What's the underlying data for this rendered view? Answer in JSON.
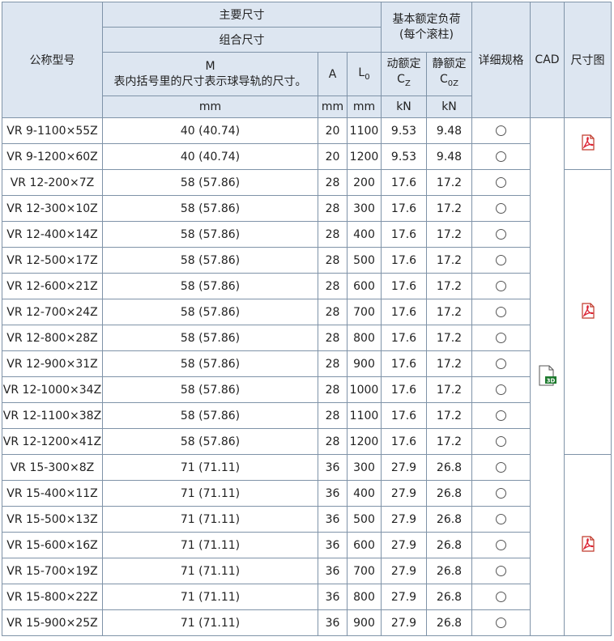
{
  "header": {
    "model": "公称型号",
    "main_dims": "主要尺寸",
    "combo_dims": "组合尺寸",
    "m_label": "M",
    "m_note": "表内括号里的尺寸表示球导轨的尺寸。",
    "a_label": "A",
    "l0_label": "L",
    "l0_sub": "0",
    "load_title": "基本额定负荷",
    "load_sub": "(每个滚柱)",
    "dyn_label": "动额定",
    "dyn_sym": "C",
    "dyn_sub": "Z",
    "stat_label": "静额定",
    "stat_sym": "C",
    "stat_sub": "0Z",
    "detail": "详细规格",
    "cad": "CAD",
    "drawing": "尺寸图",
    "unit_mm": "mm",
    "unit_kn": "kN"
  },
  "icons": {
    "detail": "circle-icon",
    "pdf": "pdf-icon",
    "cad": "cad-3d-icon"
  },
  "rows": [
    {
      "model": "VR 9-1100×55Z",
      "m": "40 (40.74)",
      "a": "20",
      "l0": "1100",
      "cz": "9.53",
      "c0z": "9.48"
    },
    {
      "model": "VR 9-1200×60Z",
      "m": "40 (40.74)",
      "a": "20",
      "l0": "1200",
      "cz": "9.53",
      "c0z": "9.48"
    },
    {
      "model": "VR 12-200×7Z",
      "m": "58 (57.86)",
      "a": "28",
      "l0": "200",
      "cz": "17.6",
      "c0z": "17.2"
    },
    {
      "model": "VR 12-300×10Z",
      "m": "58 (57.86)",
      "a": "28",
      "l0": "300",
      "cz": "17.6",
      "c0z": "17.2"
    },
    {
      "model": "VR 12-400×14Z",
      "m": "58 (57.86)",
      "a": "28",
      "l0": "400",
      "cz": "17.6",
      "c0z": "17.2"
    },
    {
      "model": "VR 12-500×17Z",
      "m": "58 (57.86)",
      "a": "28",
      "l0": "500",
      "cz": "17.6",
      "c0z": "17.2"
    },
    {
      "model": "VR 12-600×21Z",
      "m": "58 (57.86)",
      "a": "28",
      "l0": "600",
      "cz": "17.6",
      "c0z": "17.2"
    },
    {
      "model": "VR 12-700×24Z",
      "m": "58 (57.86)",
      "a": "28",
      "l0": "700",
      "cz": "17.6",
      "c0z": "17.2"
    },
    {
      "model": "VR 12-800×28Z",
      "m": "58 (57.86)",
      "a": "28",
      "l0": "800",
      "cz": "17.6",
      "c0z": "17.2"
    },
    {
      "model": "VR 12-900×31Z",
      "m": "58 (57.86)",
      "a": "28",
      "l0": "900",
      "cz": "17.6",
      "c0z": "17.2"
    },
    {
      "model": "VR 12-1000×34Z",
      "m": "58 (57.86)",
      "a": "28",
      "l0": "1000",
      "cz": "17.6",
      "c0z": "17.2"
    },
    {
      "model": "VR 12-1100×38Z",
      "m": "58 (57.86)",
      "a": "28",
      "l0": "1100",
      "cz": "17.6",
      "c0z": "17.2"
    },
    {
      "model": "VR 12-1200×41Z",
      "m": "58 (57.86)",
      "a": "28",
      "l0": "1200",
      "cz": "17.6",
      "c0z": "17.2"
    },
    {
      "model": "VR 15-300×8Z",
      "m": "71 (71.11)",
      "a": "36",
      "l0": "300",
      "cz": "27.9",
      "c0z": "26.8"
    },
    {
      "model": "VR 15-400×11Z",
      "m": "71 (71.11)",
      "a": "36",
      "l0": "400",
      "cz": "27.9",
      "c0z": "26.8"
    },
    {
      "model": "VR 15-500×13Z",
      "m": "71 (71.11)",
      "a": "36",
      "l0": "500",
      "cz": "27.9",
      "c0z": "26.8"
    },
    {
      "model": "VR 15-600×16Z",
      "m": "71 (71.11)",
      "a": "36",
      "l0": "600",
      "cz": "27.9",
      "c0z": "26.8"
    },
    {
      "model": "VR 15-700×19Z",
      "m": "71 (71.11)",
      "a": "36",
      "l0": "700",
      "cz": "27.9",
      "c0z": "26.8"
    },
    {
      "model": "VR 15-800×22Z",
      "m": "71 (71.11)",
      "a": "36",
      "l0": "800",
      "cz": "27.9",
      "c0z": "26.8"
    },
    {
      "model": "VR 15-900×25Z",
      "m": "71 (71.11)",
      "a": "36",
      "l0": "900",
      "cz": "27.9",
      "c0z": "26.8"
    }
  ],
  "drawing_groups": [
    2,
    11,
    7
  ]
}
